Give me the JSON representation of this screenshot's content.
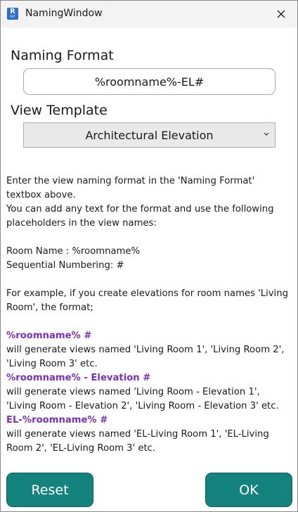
{
  "window": {
    "title": "NamingWindow",
    "app_icon_letter": "R",
    "app_icon_sub": "RVT"
  },
  "naming_format": {
    "label": "Naming Format",
    "value": "%roomname%-EL#"
  },
  "view_template": {
    "label": "View Template",
    "selected": "Architectural Elevation"
  },
  "help": {
    "line1": "Enter the view naming format in the 'Naming Format' textbox above.",
    "line2": "You can add any text for the format and use the following placeholders in the view names:",
    "room_name": "Room Name : %roomname%",
    "seq_num": "Sequential Numbering: #",
    "example_intro": "For example, if you create elevations for room names 'Living Room', the format;",
    "ex1_format": "%roomname% #",
    "ex1_result": "will generate views named 'Living Room 1', 'Living Room 2', 'Living Room 3' etc.",
    "ex2_format": "%roomname% - Elevation #",
    "ex2_result": "will generate views named 'Living Room - Elevation 1', 'Living Room - Elevation 2', 'Living Room - Elevation 3' etc.",
    "ex3_format": "EL-%roomname% #",
    "ex3_result": "will generate views named 'EL-Living Room 1', 'EL-Living Room 2', 'EL-Living Room 3' etc."
  },
  "buttons": {
    "reset": "Reset",
    "ok": "OK"
  },
  "colors": {
    "accent_button": "#14837e",
    "placeholder_highlight": "#7b2fbe",
    "app_icon": "#2e6bd1"
  }
}
